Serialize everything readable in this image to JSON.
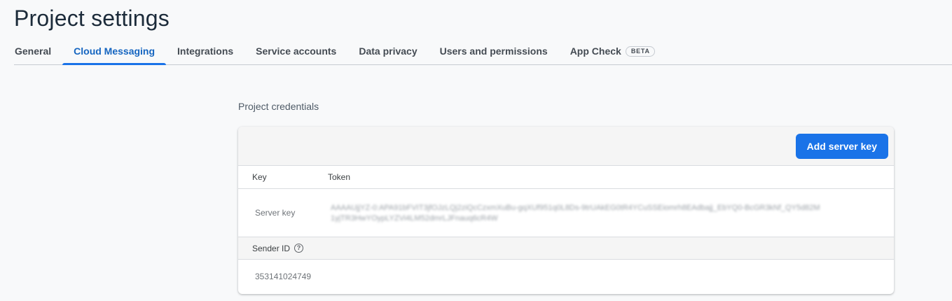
{
  "page": {
    "title": "Project settings"
  },
  "tabs": [
    {
      "label": "General",
      "active": false
    },
    {
      "label": "Cloud Messaging",
      "active": true
    },
    {
      "label": "Integrations",
      "active": false
    },
    {
      "label": "Service accounts",
      "active": false
    },
    {
      "label": "Data privacy",
      "active": false
    },
    {
      "label": "Users and permissions",
      "active": false
    },
    {
      "label": "App Check",
      "badge": "BETA",
      "active": false
    }
  ],
  "credentials": {
    "section_label": "Project credentials",
    "add_button_label": "Add server key",
    "columns": {
      "key": "Key",
      "token": "Token"
    },
    "server_key": {
      "label": "Server key",
      "token": "AAAAUjjYZ-0:APA91bFVIT3jfOJzLQj2ziQcCzxmXuBu-gqXUf951q0L8Ds-9trUAkEG0tR4YCuSSEiomrh8EAdbajj_EbYQ0-BcGR3kNf_QY5d82M1yjTR3HwYOypLYZVi4LM52dmrLJFnauq6cR4W"
    },
    "sender_id": {
      "label": "Sender ID",
      "value": "353141024749"
    }
  },
  "colors": {
    "accent": "#1a73e8",
    "active_tab_text": "#1565c0"
  }
}
